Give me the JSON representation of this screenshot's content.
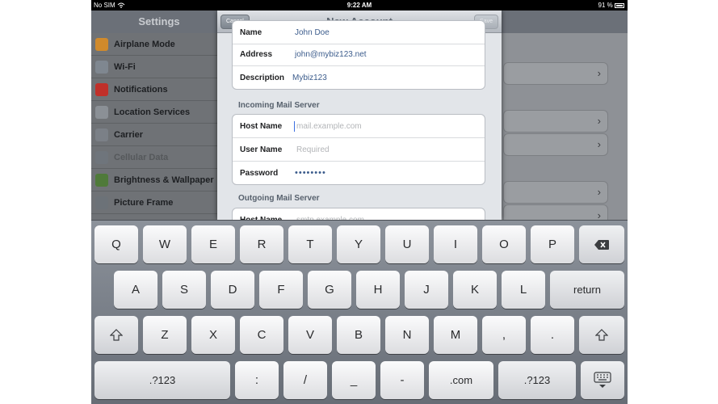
{
  "status_bar": {
    "carrier": "No SIM",
    "time": "9:22 AM",
    "battery": "91 %"
  },
  "settings": {
    "title": "Settings",
    "items": [
      {
        "label": "Airplane Mode",
        "icon": "airplane-icon",
        "color": "#d08a2c"
      },
      {
        "label": "Wi-Fi",
        "icon": "wifi-icon",
        "color": "#7f8790"
      },
      {
        "label": "Notifications",
        "icon": "notifications-icon",
        "color": "#c0302a"
      },
      {
        "label": "Location Services",
        "icon": "location-icon",
        "color": "#8b9096"
      },
      {
        "label": "Carrier",
        "icon": "carrier-icon",
        "color": "#7b8087"
      },
      {
        "label": "Cellular Data",
        "icon": "cellular-icon",
        "color": "#6f757c"
      },
      {
        "label": "Brightness & Wallpaper",
        "icon": "brightness-icon",
        "color": "#4f7a3a"
      },
      {
        "label": "Picture Frame",
        "icon": "picture-frame-icon",
        "color": "#6c7278"
      }
    ]
  },
  "modal": {
    "title": "New Account",
    "cancel_label": "Cancel",
    "save_label": "Save",
    "account": {
      "name_label": "Name",
      "name_value": "John Doe",
      "address_label": "Address",
      "address_value": "john@mybiz123.net",
      "description_label": "Description",
      "description_value": "Mybiz123"
    },
    "incoming": {
      "header": "Incoming Mail Server",
      "host_label": "Host Name",
      "host_placeholder": "mail.example.com",
      "user_label": "User Name",
      "user_placeholder": "Required",
      "password_label": "Password",
      "password_value": "••••••••"
    },
    "outgoing": {
      "header": "Outgoing Mail Server",
      "host_label": "Host Name",
      "host_placeholder": "smtp.example.com"
    }
  },
  "keyboard": {
    "row1": [
      "Q",
      "W",
      "E",
      "R",
      "T",
      "Y",
      "U",
      "I",
      "O",
      "P"
    ],
    "row2": [
      "A",
      "S",
      "D",
      "F",
      "G",
      "H",
      "J",
      "K",
      "L"
    ],
    "return_label": "return",
    "row3": [
      "Z",
      "X",
      "C",
      "V",
      "B",
      "N",
      "M",
      ",",
      "."
    ],
    "num_label": ".?123",
    "row4": [
      ":",
      "/",
      "_",
      "-"
    ],
    "dotcom_label": ".com"
  }
}
